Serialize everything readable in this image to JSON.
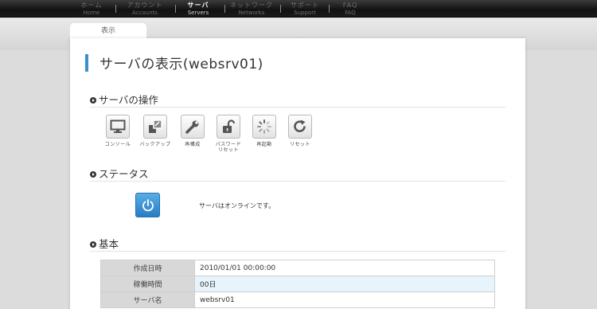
{
  "nav": {
    "items": [
      {
        "ja": "ホーム",
        "en": "Home",
        "active": false
      },
      {
        "ja": "アカウント",
        "en": "Accounts",
        "active": false
      },
      {
        "ja": "サーバ",
        "en": "Servers",
        "active": true
      },
      {
        "ja": "ネットワーク",
        "en": "Networks",
        "active": false
      },
      {
        "ja": "サポート",
        "en": "Support",
        "active": false
      },
      {
        "ja": "FAQ",
        "en": "FAQ",
        "active": false
      }
    ]
  },
  "tab": {
    "label": "表示"
  },
  "page": {
    "title": "サーバの表示(websrv01)"
  },
  "operations": {
    "heading": "サーバの操作",
    "buttons": [
      {
        "label": "コンソール",
        "icon": "monitor-icon"
      },
      {
        "label": "バックアップ",
        "icon": "backup-icon"
      },
      {
        "label": "再構成",
        "icon": "wrench-icon"
      },
      {
        "label": "パスワード\nリセット",
        "icon": "unlock-icon"
      },
      {
        "label": "再起動",
        "icon": "spinner-icon"
      },
      {
        "label": "リセット",
        "icon": "refresh-icon"
      }
    ]
  },
  "status": {
    "heading": "ステータス",
    "text": "サーバはオンラインです。",
    "icon": "power-icon",
    "color": "#3a8fd0"
  },
  "basic": {
    "heading": "基本",
    "rows": [
      {
        "key": "作成日時",
        "value": "2010/01/01 00:00:00"
      },
      {
        "key": "稼働時間",
        "value": "00日"
      },
      {
        "key": "サーバ名",
        "value": "websrv01"
      }
    ]
  },
  "colors": {
    "accent": "#3a8fd0",
    "nav_bg": "#1a1a1a",
    "highlight_row": "#e8f4fb"
  }
}
